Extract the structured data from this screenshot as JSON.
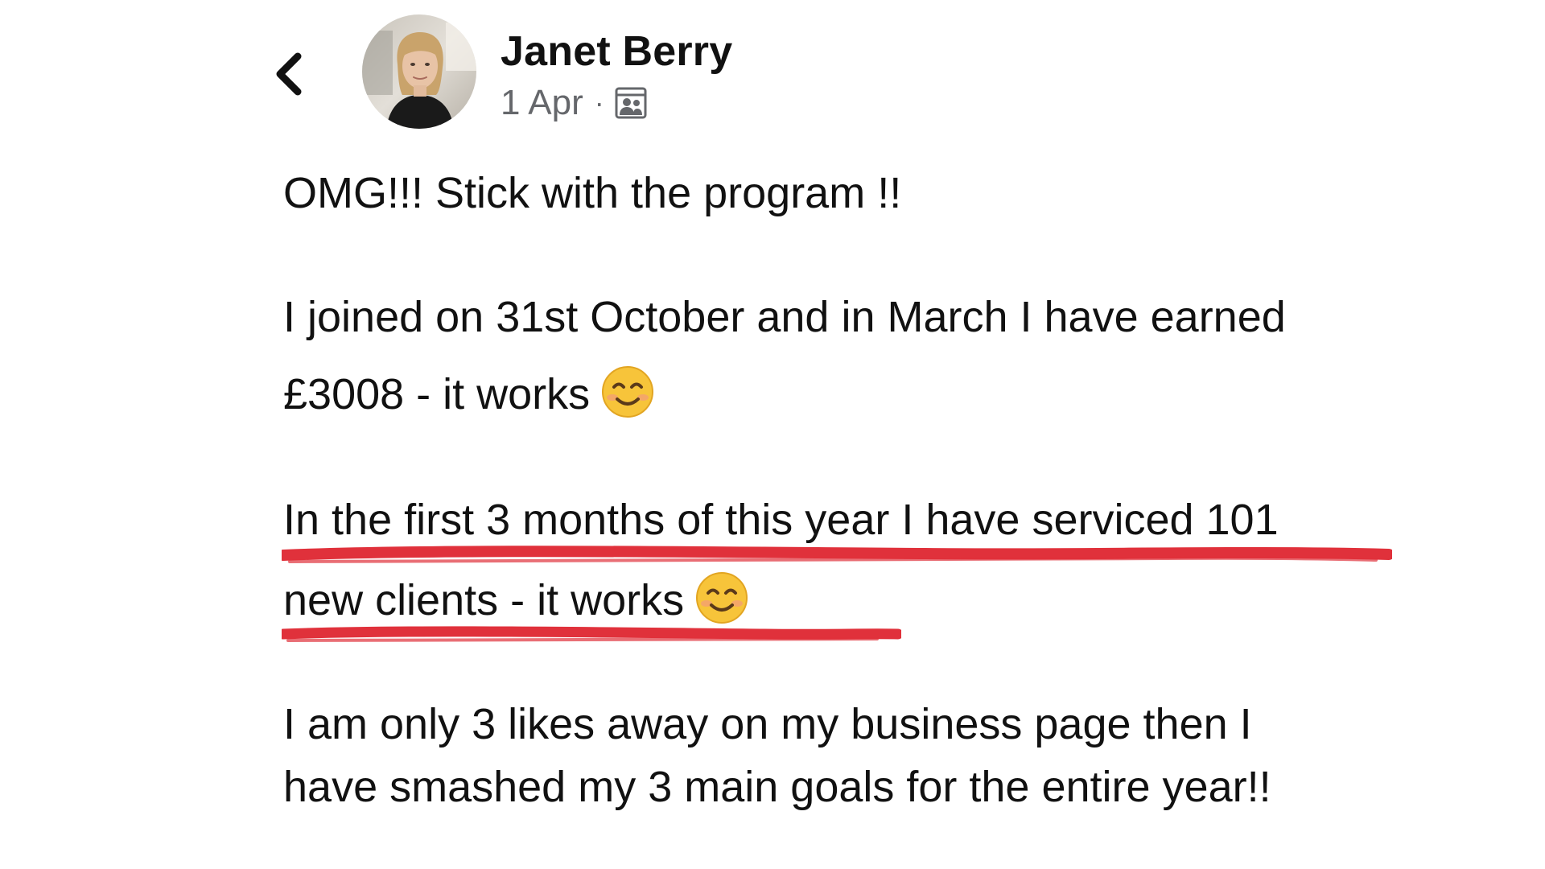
{
  "post": {
    "author_name": "Janet Berry",
    "date": "1 Apr",
    "separator": "·",
    "audience_icon": "group-audience-icon",
    "back_icon": "chevron-left-icon",
    "lines": {
      "line1": "OMG!!!  Stick with the program !!",
      "line2": "I joined on 31st October and in March I have earned",
      "line3": "£3008 - it works",
      "line4": "In the first 3 months of this year I have serviced 101",
      "line5": "new clients - it works",
      "line6": "I am only 3 likes away on my business page then I",
      "line7": "have smashed my 3 main goals for the entire year!!"
    },
    "emoji": "smiling-face-emoji"
  },
  "colors": {
    "text": "#111111",
    "meta": "#65676b",
    "underline": "#e0313b",
    "emoji_face": "#f7c43a"
  }
}
